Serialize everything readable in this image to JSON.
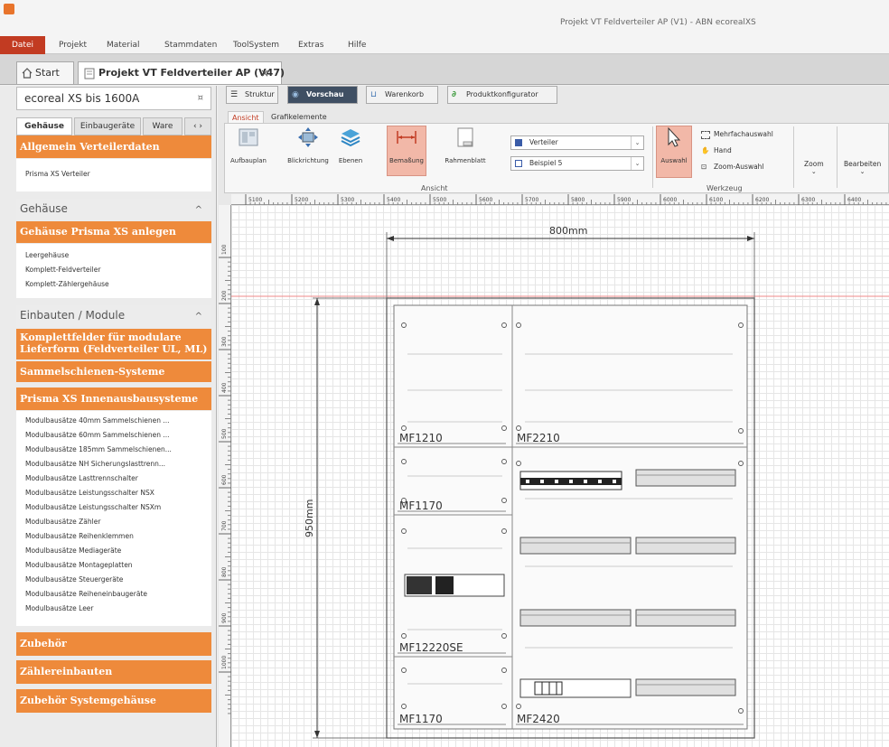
{
  "window": {
    "title": "Projekt VT Feldverteiler AP (V1) - ABN ecorealXS"
  },
  "menu": [
    "Datei",
    "Projekt",
    "Material",
    "Stammdaten",
    "ToolSystem",
    "Extras",
    "Hilfe"
  ],
  "doc_tabs": [
    {
      "label": "Start",
      "icon": "home-icon"
    },
    {
      "label": "Projekt VT Feldverteiler AP (V47)",
      "icon": "document-icon"
    }
  ],
  "left_panel": {
    "catalog": "ecoreal XS bis 1600A",
    "tabs": [
      "Gehäuse",
      "Einbaugeräte",
      "Ware"
    ],
    "cat_allgemein": "Allgemein Verteilerdaten",
    "allgemein_items": [
      "Prisma XS Verteiler"
    ],
    "sec_gehaeuse": "Gehäuse",
    "cat_gehaeuse_anlegen": "Gehäuse Prisma XS anlegen",
    "gehaeuse_items": [
      "Leergehäuse",
      "Komplett-Feldverteiler",
      "Komplett-Zählergehäuse"
    ],
    "sec_einbauten": "Einbauten / Module",
    "cat_komplettfelder": "Komplettfelder für modulare Lieferform (Feldverteiler UL, ML)",
    "cat_sammelschienen": "Sammelschienen-Systeme",
    "cat_innenausbau": "Prisma XS Innenausbausysteme",
    "innenausbau_items": [
      "Modulbausätze 40mm Sammelschienen ...",
      "Modulbausätze 60mm Sammelschienen ...",
      "Modulbausätze 185mm Sammelschienen...",
      "Modulbausätze NH Sicherungslasttrenn...",
      "Modulbausätze Lasttrennschalter",
      "Modulbausätze Leistungsschalter NSX",
      "Modulbausätze Leistungsschalter NSXm",
      "Modulbausätze Zähler",
      "Modulbausätze Reihenklemmen",
      "Modulbausätze Mediageräte",
      "Modulbausätze Montageplatten",
      "Modulbausätze Steuergeräte",
      "Modulbausätze Reiheneinbaugeräte",
      "Modulbausätze Leer"
    ],
    "cat_zubehoer": "Zubehör",
    "cat_zaehler": "Zählereinbauten",
    "cat_zubehoer_sys": "Zubehör Systemgehäuse"
  },
  "view_tabs": [
    "Struktur",
    "Vorschau",
    "Warenkorb",
    "Produktkonfigurator"
  ],
  "ribbon": {
    "tabs": [
      "Ansicht",
      "Grafikelemente"
    ],
    "buttons": [
      "Aufbauplan",
      "Blickrichtung",
      "Ebenen",
      "Bemaßung",
      "Rahmenblatt"
    ],
    "dropdown1": "Verteiler",
    "dropdown2": "Beispiel 5",
    "group_ansicht": "Ansicht",
    "auswahl": "Auswahl",
    "tools": [
      "Mehrfachauswahl",
      "Hand",
      "Zoom-Auswahl"
    ],
    "group_werkzeug": "Werkzeug",
    "zoom": "Zoom",
    "bearbeiten": "Bearbeiten"
  },
  "ruler": {
    "h_ticks": [
      "5100",
      "5200",
      "5300",
      "5400",
      "5500",
      "5600",
      "5700",
      "5800",
      "5900",
      "6000",
      "6100",
      "6200",
      "6300",
      "6400"
    ],
    "v_ticks": [
      "100",
      "200",
      "300",
      "400",
      "500",
      "600",
      "700",
      "800",
      "900",
      "1000"
    ]
  },
  "drawing": {
    "width_dim": "800mm",
    "height_dim": "950mm",
    "fields": [
      "MF1210",
      "MF2210",
      "MF1170",
      "MF12220SE",
      "MF1170",
      "MF2420"
    ]
  },
  "colors": {
    "accent": "#ee8a3b",
    "active": "#f2b8a8"
  }
}
